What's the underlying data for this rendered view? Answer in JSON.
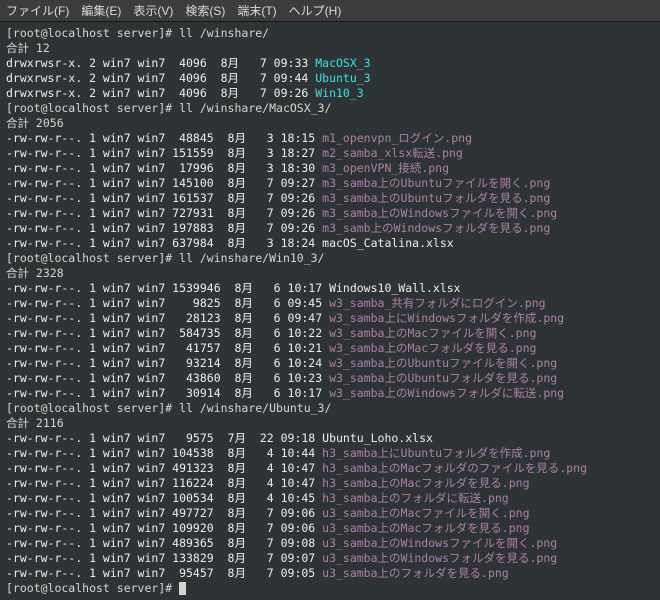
{
  "menubar": {
    "file": "ファイル(F)",
    "edit": "編集(E)",
    "view": "表示(V)",
    "search": "検索(S)",
    "terminal": "端末(T)",
    "help": "ヘルプ(H)"
  },
  "prompt0": "[root@localhost server]# ll /winshare/",
  "total0": "合計 12",
  "dirs": [
    {
      "perm": "drwxrwsr-x. 2 win7 win7  4096  8月   7 09:33 ",
      "name": "MacOSX_3"
    },
    {
      "perm": "drwxrwsr-x. 2 win7 win7  4096  8月   7 09:44 ",
      "name": "Ubuntu_3"
    },
    {
      "perm": "drwxrwsr-x. 2 win7 win7  4096  8月   7 09:26 ",
      "name": "Win10_3"
    }
  ],
  "prompt1": "[root@localhost server]# ll /winshare/MacOSX_3/",
  "total1": "合計 2056",
  "mac": [
    {
      "pre": "-rw-rw-r--. 1 win7 win7  48845  8月   3 18:15 ",
      "name": "m1_openvpn_ログイン.png"
    },
    {
      "pre": "-rw-rw-r--. 1 win7 win7 151559  8月   3 18:27 ",
      "name": "m2_samba_xlsx転送.png"
    },
    {
      "pre": "-rw-rw-r--. 1 win7 win7  17996  8月   3 18:30 ",
      "name": "m3_openVPN_接続.png"
    },
    {
      "pre": "-rw-rw-r--. 1 win7 win7 145100  8月   7 09:27 ",
      "name": "m3_samba上のUbuntuファイルを開く.png"
    },
    {
      "pre": "-rw-rw-r--. 1 win7 win7 161537  8月   7 09:26 ",
      "name": "m3_samba上のUbuntuフォルダを見る.png"
    },
    {
      "pre": "-rw-rw-r--. 1 win7 win7 727931  8月   7 09:26 ",
      "name": "m3_samba上のWindowsファイルを開く.png"
    },
    {
      "pre": "-rw-rw-r--. 1 win7 win7 197883  8月   7 09:26 ",
      "name": "m3_samb上のWindowsフォルダを見る.png"
    },
    {
      "pre": "-rw-rw-r--. 1 win7 win7 637984  8月   3 18:24 ",
      "name": "macOS_Catalina.xlsx",
      "plain": true
    }
  ],
  "prompt2": "[root@localhost server]# ll /winshare/Win10_3/",
  "total2": "合計 2328",
  "win": [
    {
      "pre": "-rw-rw-r--. 1 win7 win7 1539946  8月   6 10:17 ",
      "name": "Windows10_Wall.xlsx",
      "plain": true
    },
    {
      "pre": "-rw-rw-r--. 1 win7 win7    9825  8月   6 09:45 ",
      "name": "w3_samba_共有フォルダにログイン.png"
    },
    {
      "pre": "-rw-rw-r--. 1 win7 win7   28123  8月   6 09:47 ",
      "name": "w3_samba上にWindowsフォルダを作成.png"
    },
    {
      "pre": "-rw-rw-r--. 1 win7 win7  584735  8月   6 10:22 ",
      "name": "w3_samba上のMacファイルを開く.png"
    },
    {
      "pre": "-rw-rw-r--. 1 win7 win7   41757  8月   6 10:21 ",
      "name": "w3_samba上のMacフォルダを見る.png"
    },
    {
      "pre": "-rw-rw-r--. 1 win7 win7   93214  8月   6 10:24 ",
      "name": "w3_samba上のUbuntuファイルを開く.png"
    },
    {
      "pre": "-rw-rw-r--. 1 win7 win7   43860  8月   6 10:23 ",
      "name": "w3_samba上のUbuntuフォルダを見る.png"
    },
    {
      "pre": "-rw-rw-r--. 1 win7 win7   30914  8月   6 10:17 ",
      "name": "w3_samba上のWindowsフォルダに転送.png"
    }
  ],
  "prompt3": "[root@localhost server]# ll /winshare/Ubuntu_3/",
  "total3": "合計 2116",
  "ubu": [
    {
      "pre": "-rw-rw-r--. 1 win7 win7   9575  7月  22 09:18 ",
      "name": "Ubuntu_Loho.xlsx",
      "plain": true
    },
    {
      "pre": "-rw-rw-r--. 1 win7 win7 104538  8月   4 10:44 ",
      "name": "h3_samba上にUbuntuフォルダを作成.png"
    },
    {
      "pre": "-rw-rw-r--. 1 win7 win7 491323  8月   4 10:47 ",
      "name": "h3_samba上のMacフォルダのファイルを見る.png"
    },
    {
      "pre": "-rw-rw-r--. 1 win7 win7 116224  8月   4 10:47 ",
      "name": "h3_samba上のMacフォルダを見る.png"
    },
    {
      "pre": "-rw-rw-r--. 1 win7 win7 100534  8月   4 10:45 ",
      "name": "h3_samba上のフォルダに転送.png"
    },
    {
      "pre": "-rw-rw-r--. 1 win7 win7 497727  8月   7 09:06 ",
      "name": "u3_samba上のMacファイルを開く.png"
    },
    {
      "pre": "-rw-rw-r--. 1 win7 win7 109920  8月   7 09:06 ",
      "name": "u3_samba上のMacフォルダを見る.png"
    },
    {
      "pre": "-rw-rw-r--. 1 win7 win7 489365  8月   7 09:08 ",
      "name": "u3_samba上のWindowsファイルを開く.png"
    },
    {
      "pre": "-rw-rw-r--. 1 win7 win7 133829  8月   7 09:07 ",
      "name": "u3_samba上のWindowsフォルダを見る.png"
    },
    {
      "pre": "-rw-rw-r--. 1 win7 win7  95457  8月   7 09:05 ",
      "name": "u3_samba上のフォルダを見る.png"
    }
  ],
  "prompt4": "[root@localhost server]# "
}
